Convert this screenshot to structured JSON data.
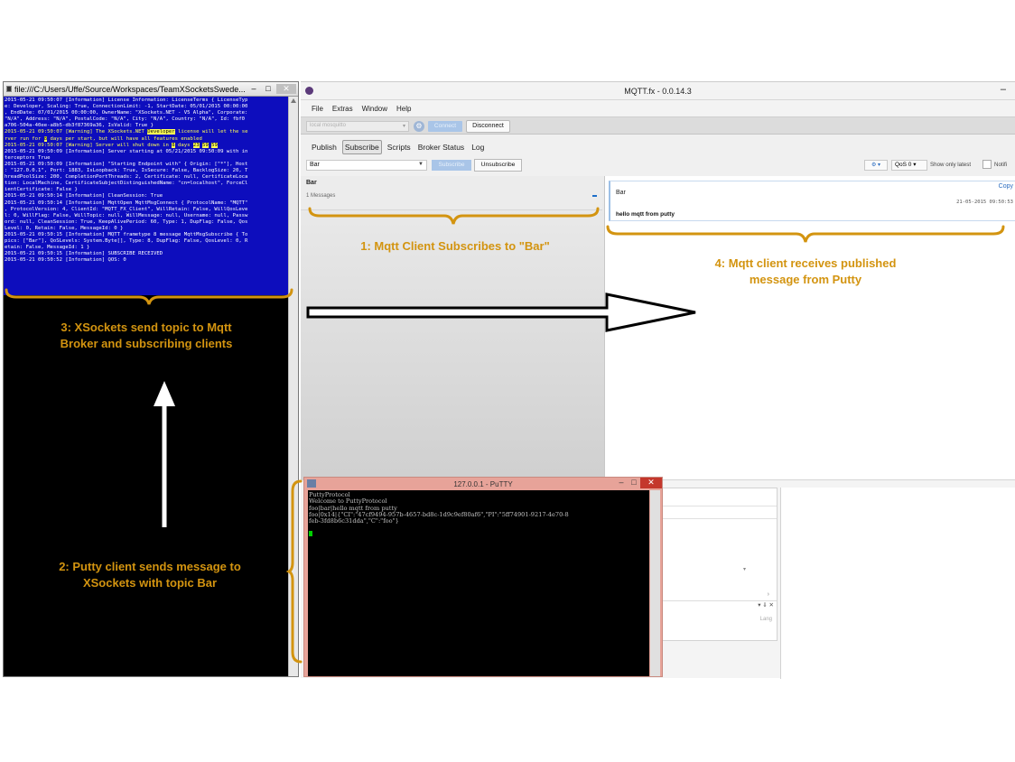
{
  "console": {
    "title": "file:///C:/Users/Uffe/Source/Workspaces/TeamXSocketsSwede...",
    "controls": {
      "minimize": "–",
      "maximize": "□",
      "close": "✕"
    },
    "lines": [
      "2015-05-21 09:50:07 [Information] License Information: LicenseTerms { LicenseTyp",
      "e: Developer, Scaling: True, ConnectionLimit: -1, StartDate: 05/01/2015 00:00:00",
      ", EndDate: 07/01/2015 00:00:00, OwnerName: \"XSockets.NET - V5 Alpha\", Corporate:",
      " \"N/A\", Address: \"N/A\", PostalCode: \"N/A\", City: \"N/A\", Country: \"N/A\", Id: fbf0",
      "a706-504a-40ee-a8b5-db3f87369a36, IsValid: True }"
    ],
    "warn1_prefix": "2015-05-21 09:50:07 [Warning] The XSockets.NET ",
    "warn1_highlight": "Developer",
    "warn1_suffix": " license will let the se",
    "warn2_prefix": "rver run for ",
    "warn2_highlight": "8",
    "warn2_suffix": " days per start, but will have all features enabled",
    "warn3_prefix": "2015-05-21 09:50:07 [Warning] Server will shut down in ",
    "warn3_h1": "8",
    "warn3_mid": " days ",
    "warn3_h2": "23",
    "warn3_h3": "59",
    "warn3_h4": "59",
    "lines2": [
      "2015-05-21 09:50:09 [Information] Server starting at 05/21/2015 09:50:09 with in",
      "terceptors True",
      "2015-05-21 09:50:09 [Information] \"Starting Endpoint with\" { Origin: [\"*\"], Host",
      ": \"127.0.0.1\", Port: 1883, IsLoopback: True, IsSecure: False, BacklogSize: 20, T",
      "hreadPoolSize: 200, CompletionPortThreads: 2, Certificate: null, CertificateLoca",
      "tion: LocalMachine, CertificateSubjectDistinguishedName: \"cn=localhost\", ForceCl",
      "ientCertificate: False }",
      "2015-05-21 09:50:14 [Information] CleanSession: True",
      "2015-05-21 09:50:14 [Information] MqttOpen MqttMsgConnect { ProtocolName: \"MQTT\"",
      ", ProtocolVersion: 4, ClientId: \"MQTT_FX_Client\", WillRetain: False, WillQosLeve",
      "l: 0, WillFlag: False, WillTopic: null, WillMessage: null, Username: null, Passw",
      "ord: null, CleanSession: True, KeepAlivePeriod: 60, Type: 1, DupFlag: False, Qos",
      "Level: 0, Retain: False, MessageId: 0 }",
      "2015-05-21 09:50:15 [Information] MQTT frametype 8 message MqttMsgSubscribe { To",
      "pics: [\"Bar\"], QoSLevels: System.Byte[], Type: 8, DupFlag: False, QosLevel: 0, R",
      "etain: False, MessageId: 1 }",
      "2015-05-21 09:50:15 [Information] SUBSCRIBE RECEIVED",
      "2015-05-21 09:50:52 [Information] QOS: 0"
    ]
  },
  "mqtt": {
    "title": "MQTT.fx - 0.0.14.3",
    "minimize": "–",
    "menu": [
      "File",
      "Extras",
      "Window",
      "Help"
    ],
    "broker_placeholder": "local mosquitto",
    "connect_label": "Connect",
    "disconnect_label": "Disconnect",
    "tabs": [
      "Publish",
      "Subscribe",
      "Scripts",
      "Broker Status",
      "Log"
    ],
    "topic_value": "Bar",
    "subscribe_label": "Subscribe",
    "unsubscribe_label": "Unsubscribe",
    "qos_label": "QoS 0",
    "show_latest_label": "Show only latest",
    "notify_label": "Notifi",
    "topic_list": {
      "name": "Bar",
      "count": "1 Messages"
    },
    "message": {
      "topic": "Bar",
      "copy_label": "Copy",
      "timestamp": "21-05-2015 09:50:53",
      "payload": "hello mqtt from putty"
    },
    "panel_lang": "Lang"
  },
  "putty": {
    "title": "127.0.0.1 - PuTTY",
    "lines": [
      "PuttyProtocol",
      "Welcome to PuttyProtocol",
      "foo|bar|hello mqtt from putty",
      "foo|0x14|{\"CI\":\"47cf9494-957b-4657-bd8c-1d9c9ef80af6\",\"PI\":\"5ff74901-9217-4e70-8",
      "feb-3fd8b6c31dda\",\"C\":\"foo\"}"
    ]
  },
  "annotations": {
    "a1": "1: Mqtt Client Subscribes to \"Bar\"",
    "a2_line1": "2: Putty client sends message to",
    "a2_line2": "XSockets with topic Bar",
    "a3_line1": "3: XSockets send topic to Mqtt",
    "a3_line2": "Broker and subscribing clients",
    "a4_line1": "4: Mqtt client receives published",
    "a4_line2": "message from Putty"
  },
  "colors": {
    "annotation": "#d39410",
    "console_bg": "#0d0dbd",
    "console_warning": "#ffff55",
    "mqtt_accent": "#2a6cc0",
    "putty_title": "#e7a399",
    "putty_close": "#c4372c"
  }
}
